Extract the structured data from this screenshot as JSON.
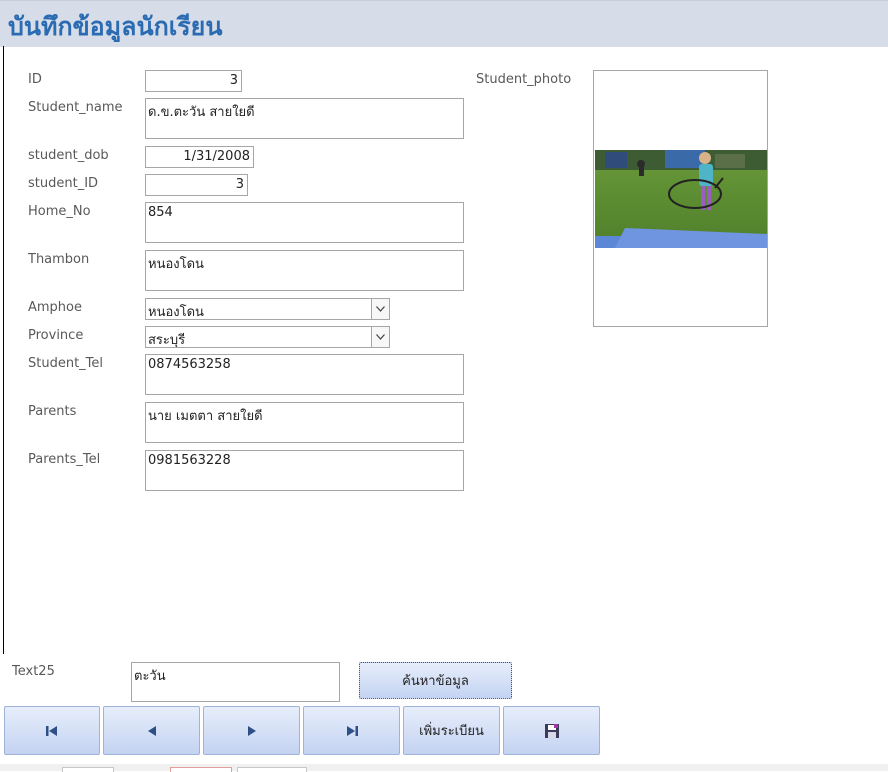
{
  "header": {
    "title": "บันทึกข้อมูลนักเรียน"
  },
  "fields": {
    "id": {
      "label": "ID",
      "value": "3"
    },
    "student_name": {
      "label": "Student_name",
      "value": "ด.ข.ตะวัน สายใยดี"
    },
    "student_dob": {
      "label": "student_dob",
      "value": "1/31/2008"
    },
    "student_id": {
      "label": "student_ID",
      "value": "3"
    },
    "home_no": {
      "label": "Home_No",
      "value": "854"
    },
    "thambon": {
      "label": "Thambon",
      "value": "หนองโดน"
    },
    "amphoe": {
      "label": "Amphoe",
      "value": "หนองโดน"
    },
    "province": {
      "label": "Province",
      "value": "สระบุรี"
    },
    "student_tel": {
      "label": "Student_Tel",
      "value": "0874563258"
    },
    "parents": {
      "label": "Parents",
      "value": "นาย เมตตา สายใยดี"
    },
    "parents_tel": {
      "label": "Parents_Tel",
      "value": "0981563228"
    }
  },
  "photo": {
    "label": "Student_photo"
  },
  "search": {
    "label": "Text25",
    "value": "ตะวัน",
    "button_label": "ค้นหาข้อมูล"
  },
  "nav": {
    "add_label": "เพิ่มระเบียน"
  },
  "colors": {
    "header_bg": "#d6dde8",
    "title": "#2a6bb2",
    "button": "#c4d3f2"
  }
}
